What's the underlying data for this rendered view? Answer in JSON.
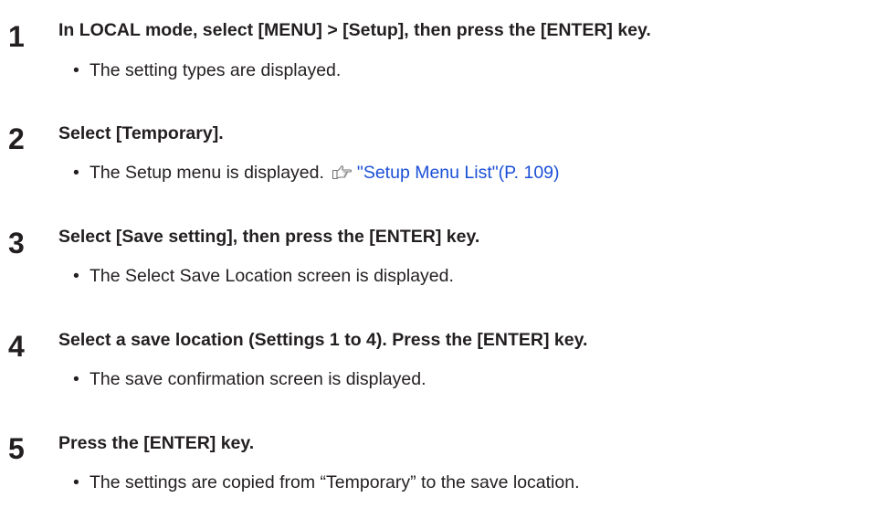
{
  "steps": [
    {
      "number": "1",
      "heading": "In LOCAL mode, select [MENU] > [Setup], then press the [ENTER] key.",
      "note": "The setting types are displayed."
    },
    {
      "number": "2",
      "heading": "Select [Temporary].",
      "note": "The Setup menu is displayed.",
      "reference": {
        "icon": "pointing-hand-icon",
        "link_text": "\"Setup Menu List\"(P. 109)",
        "color": "#1a4fd6"
      }
    },
    {
      "number": "3",
      "heading": "Select [Save setting], then press the [ENTER] key.",
      "note": "The Select Save Location screen is displayed."
    },
    {
      "number": "4",
      "heading": "Select a save location (Settings 1 to 4). Press the [ENTER] key.",
      "note": "The save confirmation screen is displayed."
    },
    {
      "number": "5",
      "heading": "Press the [ENTER] key.",
      "note": "The settings are copied from “Temporary” to the save location."
    }
  ],
  "bullet_glyph": "•"
}
